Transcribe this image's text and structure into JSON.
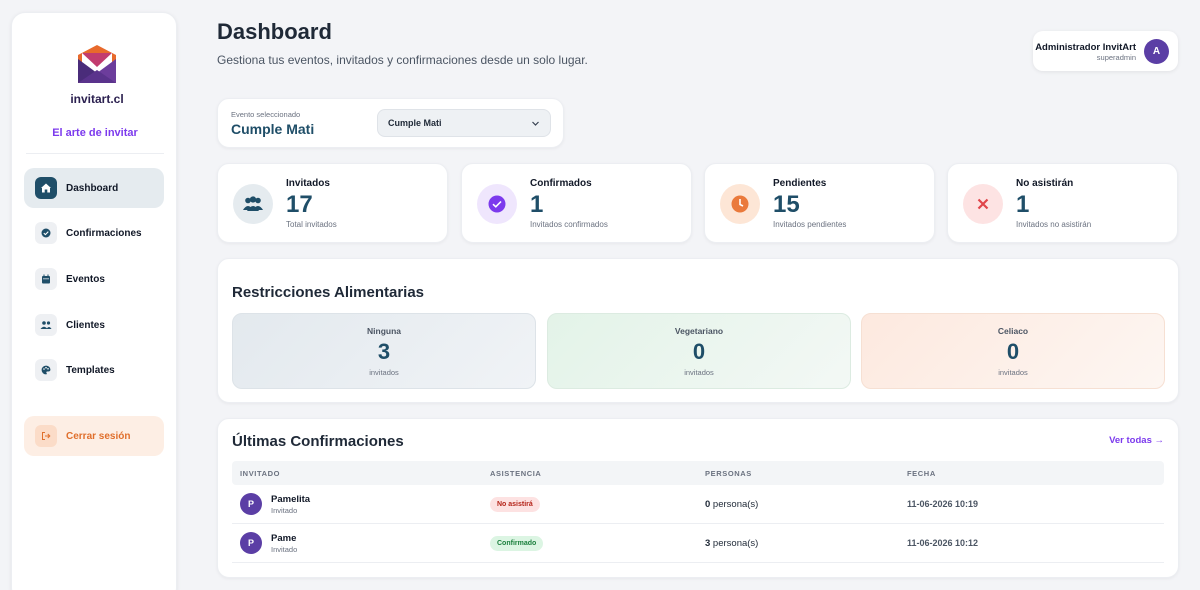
{
  "sidebar": {
    "logo_text": "invitart.cl",
    "tagline": "El arte de invitar",
    "items": [
      {
        "label": "Dashboard",
        "icon": "home-icon"
      },
      {
        "label": "Confirmaciones",
        "icon": "check-circle-icon"
      },
      {
        "label": "Eventos",
        "icon": "calendar-icon"
      },
      {
        "label": "Clientes",
        "icon": "users-icon"
      },
      {
        "label": "Templates",
        "icon": "palette-icon"
      }
    ],
    "logout_label": "Cerrar sesión"
  },
  "header": {
    "title": "Dashboard",
    "subtitle": "Gestiona tus eventos, invitados y confirmaciones desde un solo lugar."
  },
  "user": {
    "name": "Administrador InvitArt",
    "role": "superadmin",
    "initial": "A"
  },
  "event": {
    "label": "Evento seleccionado",
    "name": "Cumple Mati",
    "selected_option": "Cumple Mati"
  },
  "stats": [
    {
      "label": "Invitados",
      "value": "17",
      "sub": "Total invitados",
      "icon": "users-icon",
      "color": "#1f4e68"
    },
    {
      "label": "Confirmados",
      "value": "1",
      "sub": "Invitados confirmados",
      "icon": "check-circle-icon",
      "color": "#7c3aed"
    },
    {
      "label": "Pendientes",
      "value": "15",
      "sub": "Invitados pendientes",
      "icon": "clock-icon",
      "color": "#ea7a3c"
    },
    {
      "label": "No asistirán",
      "value": "1",
      "sub": "Invitados no asistirán",
      "icon": "x-icon",
      "color": "#e0454a"
    }
  ],
  "restrictions": {
    "title": "Restricciones Alimentarias",
    "items": [
      {
        "name": "Ninguna",
        "count": "3",
        "sub": "invitados"
      },
      {
        "name": "Vegetariano",
        "count": "0",
        "sub": "invitados"
      },
      {
        "name": "Celiaco",
        "count": "0",
        "sub": "invitados"
      }
    ]
  },
  "confirmations": {
    "title": "Últimas Confirmaciones",
    "see_all": "Ver todas →",
    "columns": [
      "INVITADO",
      "ASISTENCIA",
      "PERSONAS",
      "FECHA"
    ],
    "rows": [
      {
        "initial": "P",
        "name": "Pamelita",
        "role": "Invitado",
        "status": "No asistirá",
        "persons": "0",
        "persons_suffix": " persona(s)",
        "date": "11-06-2026 10:19"
      },
      {
        "initial": "P",
        "name": "Pame",
        "role": "Invitado",
        "status": "Confirmado",
        "persons": "3",
        "persons_suffix": " persona(s)",
        "date": "11-06-2026 10:12"
      }
    ]
  },
  "colors": {
    "accent": "#7c3aed",
    "primary": "#1f4e68",
    "logout": "#e06f2c"
  }
}
